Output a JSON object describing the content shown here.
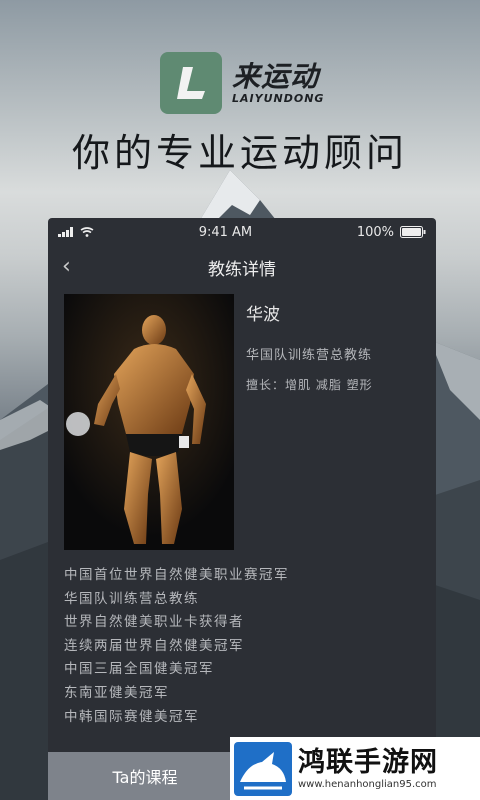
{
  "brand": {
    "name_cn": "来运动",
    "name_en": "LAIYUNDONG",
    "logo_letter": "L",
    "accent": "#5f8a72"
  },
  "slogan": "你的专业运动顾问",
  "phone": {
    "status": {
      "time": "9:41 AM",
      "battery": "100%"
    },
    "nav": {
      "title": "教练详情",
      "back_icon": "chevron-left-icon"
    },
    "coach": {
      "name": "华波",
      "title": "华国队训练营总教练",
      "skills": "擅长：增肌  减脂  塑形",
      "honors": [
        "中国首位世界自然健美职业赛冠军",
        "华国队训练营总教练",
        "世界自然健美职业卡获得者",
        "连续两届世界自然健美冠军",
        "中国三届全国健美冠军",
        "东南亚健美冠军",
        "中韩国际赛健美冠军"
      ]
    },
    "tabs": [
      {
        "label": "Ta的课程"
      },
      {
        "label": ""
      }
    ]
  },
  "watermark": {
    "name": "鸿联手游网",
    "url": "www.henanhonglian95.com"
  }
}
